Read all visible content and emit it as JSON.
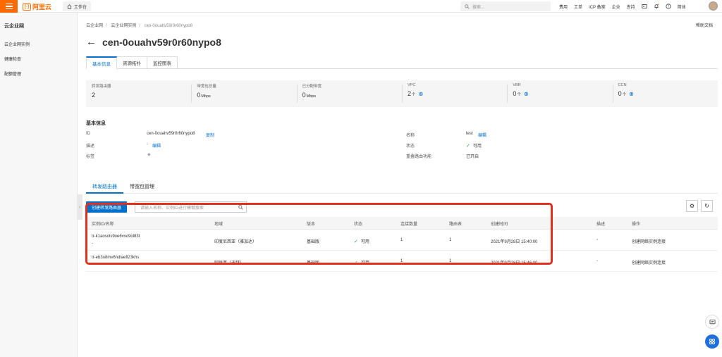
{
  "topbar": {
    "brand_mark": "[-]",
    "brand": "阿里云",
    "workbench": "工作台",
    "search_placeholder": "搜索...",
    "nav": [
      "费用",
      "工单",
      "ICP 备案",
      "企业",
      "支持"
    ],
    "lang": "简体"
  },
  "sidebar": {
    "title": "云企业网",
    "items": [
      "云企业网实例",
      "健康检查",
      "配额管理"
    ]
  },
  "breadcrumb": [
    "云企业网",
    "云企业网实例",
    "cen-0ouahv59r0r60nypo8"
  ],
  "help": "帮助文档",
  "page_title": "cen-0ouahv59r0r60nypo8",
  "tabs": [
    "基本信息",
    "资源拓扑",
    "监控图表"
  ],
  "stats": [
    {
      "label": "转发路由器",
      "value": "2",
      "unit": "",
      "plus": false
    },
    {
      "label": "带宽包总量",
      "value": "0",
      "unit": "Mbps",
      "plus": false
    },
    {
      "label": "已分配带宽",
      "value": "0",
      "unit": "Mbps",
      "plus": false
    },
    {
      "label": "VPC",
      "value": "2",
      "unit": "个",
      "plus": true
    },
    {
      "label": "VBR",
      "value": "0",
      "unit": "个",
      "plus": true
    },
    {
      "label": "CCN",
      "value": "0",
      "unit": "个",
      "plus": true
    }
  ],
  "basic": {
    "section_title": "基本信息",
    "id_label": "ID",
    "id_value": "cen-0ouahv59r0r60nypo8",
    "copy": "复制",
    "desc_label": "描述",
    "desc_value": "-",
    "edit": "编辑",
    "tag_label": "标签",
    "name_label": "名称",
    "name_value": "test",
    "status_label": "状态",
    "status_value": "可用",
    "overlap_label": "重叠路由功能",
    "overlap_value": "已开启"
  },
  "subtabs": [
    "转发路由器",
    "带宽包管理"
  ],
  "toolbar": {
    "create": "创建转发路由器",
    "search_placeholder": "请输入名称、实例ID进行模糊搜索"
  },
  "table": {
    "headers": [
      "实例ID/名称",
      "地域",
      "版本",
      "状态",
      "连接数量",
      "路由表",
      "创建时间",
      "描述",
      "操作"
    ],
    "rows": [
      {
        "id": "tr-k1aosols9oe6vxo9ol83t",
        "name": "-",
        "region": "印度尼西亚（雅加达）",
        "version": "基础版",
        "status": "可用",
        "conns": "1",
        "routes": "1",
        "created": "2021年9月28日 15:40:00",
        "desc": "-",
        "action": "创建网络实例连接"
      },
      {
        "id": "tr-eb3u8mv6hdlaefl23khs",
        "name": "-",
        "region": "阿联酋（迪拜）",
        "version": "基础版",
        "status": "可用",
        "conns": "1",
        "routes": "1",
        "created": "2021年9月28日 15:46:00",
        "desc": "-",
        "action": "创建网络实例连接"
      }
    ]
  },
  "colors": {
    "accent": "#0070cc",
    "brand": "#ff6a00",
    "highlight": "#e0301e",
    "ok": "#1c9a3e"
  }
}
